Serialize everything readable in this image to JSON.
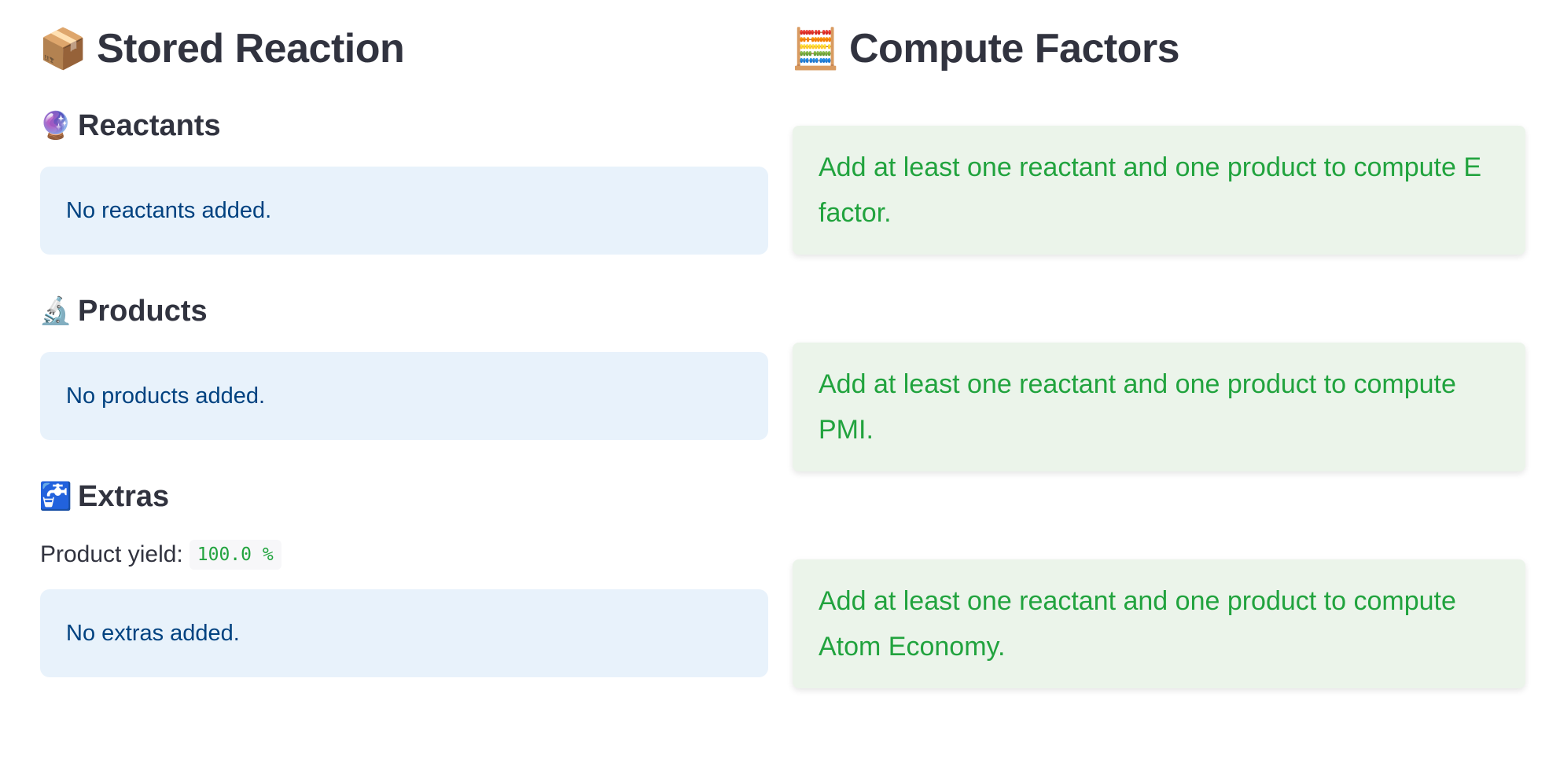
{
  "stored_reaction": {
    "icon": "package-icon",
    "title": "Stored Reaction",
    "reactants": {
      "icon": "crystal-ball-icon",
      "heading": "Reactants",
      "empty_message": "No reactants added."
    },
    "products": {
      "icon": "microscope-icon",
      "heading": "Products",
      "empty_message": "No products added."
    },
    "extras": {
      "icon": "faucet-icon",
      "heading": "Extras",
      "yield_label": "Product yield:",
      "yield_value": "100.0 %",
      "empty_message": "No extras added."
    }
  },
  "compute_factors": {
    "icon": "abacus-icon",
    "title": "Compute Factors",
    "messages": {
      "e_factor": "Add at least one reactant and one product to compute E factor.",
      "pmi": "Add at least one reactant and one product to compute PMI.",
      "atom_economy": "Add at least one reactant and one product to compute Atom Economy."
    }
  },
  "colors": {
    "info_bg": "#e8f2fb",
    "info_text": "#004280",
    "success_bg": "#ebf4ea",
    "success_text": "#21a33e",
    "heading_text": "#31333f"
  }
}
